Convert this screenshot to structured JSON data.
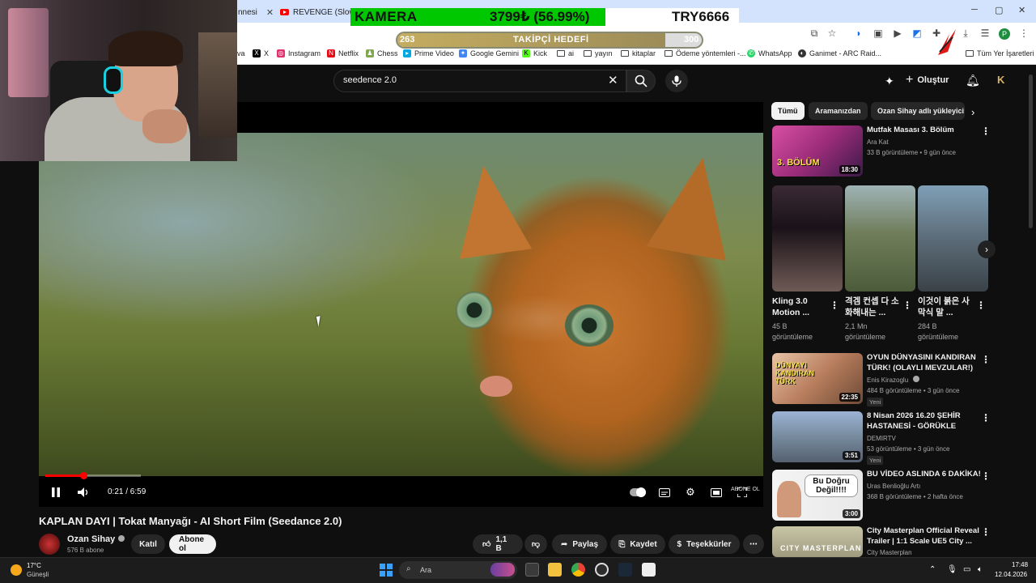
{
  "browser": {
    "tabs": [
      {
        "label": "nnesi"
      },
      {
        "label": "REVENGE (Slowed)"
      }
    ],
    "bookmarks": [
      {
        "label": "X",
        "icon": "x-icon",
        "color": "#000000"
      },
      {
        "label": "Instagram",
        "icon": "instagram-icon",
        "color": "#e1306c"
      },
      {
        "label": "Netflix",
        "icon": "netflix-icon",
        "color": "#e50914"
      },
      {
        "label": "Chess",
        "icon": "chess-icon",
        "color": "#7fa650"
      },
      {
        "label": "Prime Video",
        "icon": "prime-video-icon",
        "color": "#00a8e1"
      },
      {
        "label": "Google Gemini",
        "icon": "gemini-icon",
        "color": "#4285f4"
      },
      {
        "label": "Kick",
        "icon": "kick-icon",
        "color": "#53fc18"
      },
      {
        "label": "ai",
        "icon": "folder-icon",
        "color": ""
      },
      {
        "label": "yayın",
        "icon": "folder-icon",
        "color": ""
      },
      {
        "label": "kitaplar",
        "icon": "folder-icon",
        "color": ""
      },
      {
        "label": "Ödeme yöntemleri -...",
        "icon": "folder-icon",
        "color": ""
      },
      {
        "label": "WhatsApp",
        "icon": "whatsapp-icon",
        "color": "#25d366"
      },
      {
        "label": "Ganimet - ARC Raid...",
        "icon": "arc-icon",
        "color": "#333333"
      },
      {
        "label": "Tüm Yer İşaretleri",
        "icon": "folder-icon",
        "color": ""
      }
    ],
    "profile_initial": "P"
  },
  "stream_overlay": {
    "camera_label": "KAMERA",
    "camera_value": "3799₺ (56.99%)",
    "camera_code": "TRY6666",
    "camera_progress": 0.5699,
    "goal_start": "263",
    "goal_label": "TAKİPÇİ HEDEFİ",
    "goal_end": "300",
    "goal_progress": 0.88
  },
  "youtube": {
    "search_query": "seedence 2.0",
    "create_label": "Oluştur",
    "player": {
      "time": "0:21 / 6:59",
      "progress": 0.05,
      "watermark": "ABONE OL"
    },
    "video_title": "KAPLAN DAYI | Tokat Manyağı - AI Short Film (Seedance 2.0)",
    "channel_name": "Ozan Sihay",
    "channel_subs": "576 B abone",
    "join_label": "Katıl",
    "subscribe_label": "Abone ol",
    "likes": "1,1 B",
    "share_label": "Paylaş",
    "save_label": "Kaydet",
    "thanks_label": "Teşekkürler",
    "chips": [
      "Tümü",
      "Aramanızdan",
      "Ozan Sihay adlı yükleyici"
    ],
    "top_video": {
      "title": "Mutfak Masası 3. Bölüm",
      "channel": "Ara Kat",
      "meta": "33 B görüntüleme • 9 gün önce",
      "duration": "18:30",
      "thumb_text": "3. BÖLÜM"
    },
    "shorts": [
      {
        "title": "Kling 3.0 Motion ...",
        "views": "45 B",
        "views_unit": "görüntüleme"
      },
      {
        "title": "격겜 컨셉 다 소화해내는 ...",
        "views": "2,1 Mn",
        "views_unit": "görüntüleme"
      },
      {
        "title": "이것이 붉은 사막식 말 ...",
        "views": "284 B",
        "views_unit": "görüntüleme"
      }
    ],
    "videos": [
      {
        "title_1": "OYUN DÜNYASINI KANDIRAN",
        "title_2": "TÜRK! (OLAYLI MEVZULAR!)",
        "channel": "Enis Kirazoglu",
        "meta": "484 B görüntüleme • 3 gün önce",
        "badge": "Yeni",
        "duration": "22:35",
        "thumb_text": "DÜNYAYI KANDIRAN TÜRK"
      },
      {
        "title_1": "8 Nisan 2026  16.20  ŞEHİR",
        "title_2": "HASTANESİ  -  GÖRÜKLE",
        "channel": "DEMIRTV",
        "meta": "53 görüntüleme • 3 gün önce",
        "badge": "Yeni",
        "duration": "3:51",
        "thumb_text": ""
      },
      {
        "title_1": "BU VİDEO ASLINDA 6 DAKİKA!",
        "title_2": "",
        "channel": "Uras Benlioğlu Artı",
        "meta": "368 B görüntüleme • 2 hafta önce",
        "badge": "",
        "duration": "3:00",
        "thumb_text": "Bu Doğru Değil!!!!"
      },
      {
        "title_1": "City Masterplan Official Reveal",
        "title_2": "Trailer | 1:1 Scale UE5 City ...",
        "channel": "City Masterplan",
        "meta": "",
        "badge": "",
        "duration": "",
        "thumb_text": "CITY MASTERPLAN"
      }
    ]
  },
  "taskbar": {
    "temperature": "17°C",
    "weather": "Güneşli",
    "search_placeholder": "Ara",
    "time": "17:48",
    "date": "12.04.2026"
  }
}
